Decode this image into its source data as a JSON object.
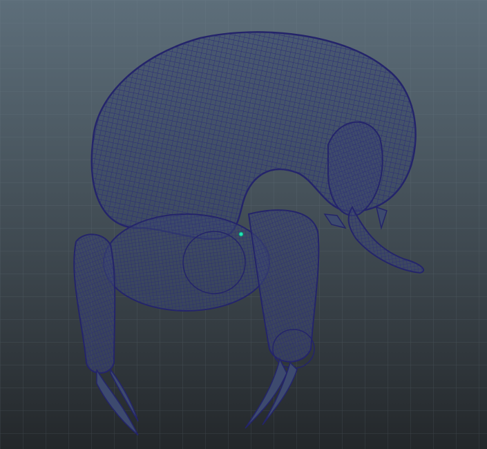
{
  "viewport": {
    "background_top": "#5d6e7a",
    "background_bottom": "#23272a",
    "grid_color": "#7a8a96",
    "wire_color": "#2a2a78",
    "mesh_fill": "#3d4a6e",
    "pivot_color": "#22e4b8"
  },
  "scene": {
    "model": "creature-wireframe-mesh",
    "display_mode": "wireframe",
    "selected_pivot": "pivot-marker"
  }
}
